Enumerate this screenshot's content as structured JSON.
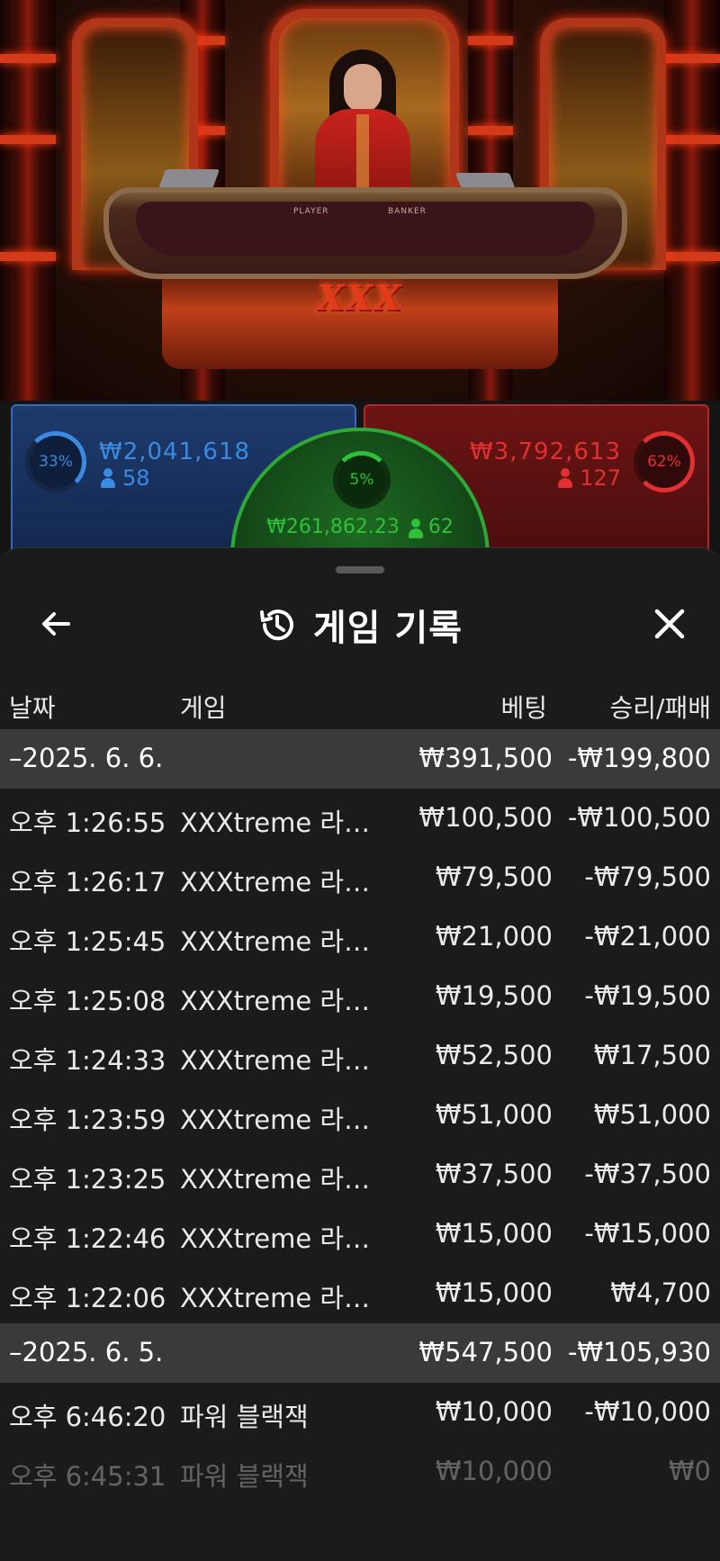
{
  "video": {
    "logo_text": "XXX",
    "felt_player": "PLAYER",
    "felt_banker": "BANKER"
  },
  "bets": {
    "player": {
      "percent": "33%",
      "amount": "₩2,041,618",
      "players": "58",
      "color": "#3a8ae0"
    },
    "banker": {
      "percent": "62%",
      "amount": "₩3,792,613",
      "players": "127",
      "color": "#e03030"
    },
    "tie": {
      "percent": "5%",
      "amount": "₩261,862.23",
      "players": "62",
      "color": "#2ec036"
    }
  },
  "sheet": {
    "title": "게임 기록",
    "columns": {
      "date": "날짜",
      "game": "게임",
      "bet": "베팅",
      "win_loss": "승리/패배"
    },
    "groups": [
      {
        "date": "–2025. 6. 6.",
        "bet": "₩391,500",
        "win_loss": "-₩199,800",
        "rows": [
          {
            "time": "오후 1:26:55",
            "game": "XXXtreme 라이트닝 바카라",
            "bet": "₩100,500",
            "win_loss": "-₩100,500"
          },
          {
            "time": "오후 1:26:17",
            "game": "XXXtreme 라이트닝 바카라",
            "bet": "₩79,500",
            "win_loss": "-₩79,500"
          },
          {
            "time": "오후 1:25:45",
            "game": "XXXtreme 라이트닝 바카라",
            "bet": "₩21,000",
            "win_loss": "-₩21,000"
          },
          {
            "time": "오후 1:25:08",
            "game": "XXXtreme 라이트닝 바카라",
            "bet": "₩19,500",
            "win_loss": "-₩19,500"
          },
          {
            "time": "오후 1:24:33",
            "game": "XXXtreme 라이트닝 바카라",
            "bet": "₩52,500",
            "win_loss": "₩17,500"
          },
          {
            "time": "오후 1:23:59",
            "game": "XXXtreme 라이트닝 바카라",
            "bet": "₩51,000",
            "win_loss": "₩51,000"
          },
          {
            "time": "오후 1:23:25",
            "game": "XXXtreme 라이트닝 바카라",
            "bet": "₩37,500",
            "win_loss": "-₩37,500"
          },
          {
            "time": "오후 1:22:46",
            "game": "XXXtreme 라이트닝 바카라",
            "bet": "₩15,000",
            "win_loss": "-₩15,000"
          },
          {
            "time": "오후 1:22:06",
            "game": "XXXtreme 라이트닝 바카라",
            "bet": "₩15,000",
            "win_loss": "₩4,700"
          }
        ]
      },
      {
        "date": "–2025. 6. 5.",
        "bet": "₩547,500",
        "win_loss": "-₩105,930",
        "rows": [
          {
            "time": "오후 6:46:20",
            "game": "파워 블랙잭",
            "bet": "₩10,000",
            "win_loss": "-₩10,000"
          },
          {
            "time": "오후 6:45:31",
            "game": "파워 블랙잭",
            "bet": "₩10,000",
            "win_loss": "₩0"
          }
        ]
      }
    ]
  }
}
